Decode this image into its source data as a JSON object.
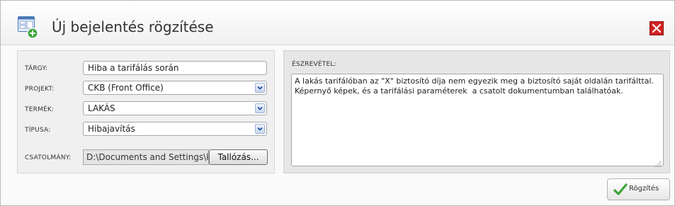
{
  "dialog": {
    "title": "Új bejelentés rögzítése",
    "icons": {
      "app": "form-add-icon",
      "close": "close-icon"
    }
  },
  "form": {
    "subject": {
      "label": "TÁRGY:",
      "value": "Hiba a tarifálás során"
    },
    "project": {
      "label": "PROJEKT:",
      "value": "CKB (Front Office)"
    },
    "product": {
      "label": "TERMÉK:",
      "value": "LAKÁS"
    },
    "type": {
      "label": "TÍPUSA:",
      "value": "Hibajavítás"
    },
    "attachment": {
      "label": "CSATOLMÁNY:",
      "value": "D:\\Documents and Settings\\k",
      "browse_label": "Tallózás..."
    }
  },
  "note": {
    "label": "ÉSZREVÉTEL:",
    "value": "A lakás tarifálóban az \"X\" biztosító díja nem egyezik meg a biztosító saját oldalán tarifálttal.\nKépernyő képek, és a tarifálási paraméterek  a csatolt dokumentumban találhatóak."
  },
  "actions": {
    "save_label": "Rögzítés",
    "save_icon": "checkmark-icon"
  },
  "colors": {
    "close_red": "#d32222",
    "check_green": "#3aa53a",
    "select_arrow_blue": "#c9d7ee"
  }
}
